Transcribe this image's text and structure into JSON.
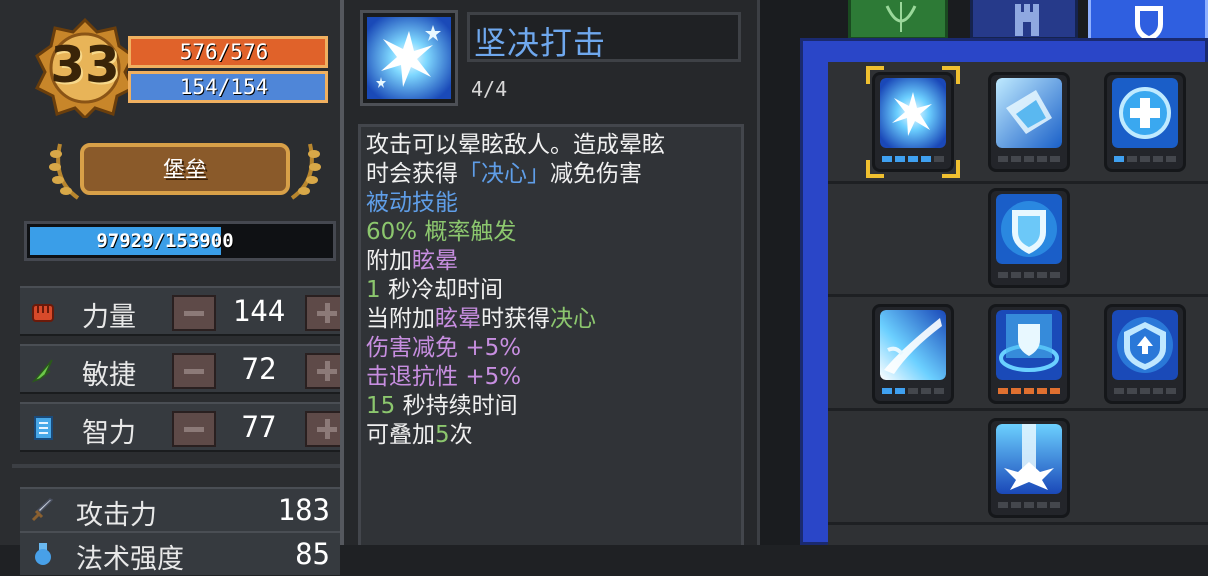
{
  "character": {
    "level": "33",
    "hp": "576/576",
    "mp": "154/154",
    "class_name": "堡垒",
    "xp": "97929/153900",
    "xp_fraction": 0.636
  },
  "attributes": [
    {
      "label": "力量",
      "value": "144",
      "icon": "fist-icon"
    },
    {
      "label": "敏捷",
      "value": "72",
      "icon": "feather-icon"
    },
    {
      "label": "智力",
      "value": "77",
      "icon": "book-icon"
    }
  ],
  "combat_stats": [
    {
      "label": "攻击力",
      "value": "183",
      "icon": "sword-icon"
    },
    {
      "label": "法术强度",
      "value": "85",
      "icon": "potion-icon"
    }
  ],
  "tooltip": {
    "skill_name": "坚决打击",
    "skill_level": "4/4",
    "lines": [
      [
        {
          "t": "攻击可以晕眩敌人。造成晕眩",
          "c": ""
        }
      ],
      [
        {
          "t": "时会获得",
          "c": ""
        },
        {
          "t": "「决心」",
          "c": "blue"
        },
        {
          "t": "减免伤害",
          "c": ""
        }
      ],
      [
        {
          "t": "被动技能",
          "c": "blue"
        }
      ],
      [
        {
          "t": "60% 概率触发",
          "c": "green"
        }
      ],
      [
        {
          "t": "附加",
          "c": ""
        },
        {
          "t": "眩晕",
          "c": "purple"
        }
      ],
      [
        {
          "t": "1",
          "c": "green"
        },
        {
          "t": " 秒冷却时间",
          "c": ""
        }
      ],
      [
        {
          "t": "当附加",
          "c": ""
        },
        {
          "t": "眩晕",
          "c": "purple"
        },
        {
          "t": "时获得",
          "c": ""
        },
        {
          "t": "决心",
          "c": "green"
        }
      ],
      [
        {
          "t": "伤害减免 ",
          "c": "purple"
        },
        {
          "t": "+5%",
          "c": "purple"
        }
      ],
      [
        {
          "t": "击退抗性 ",
          "c": "purple"
        },
        {
          "t": "+5%",
          "c": "purple"
        }
      ],
      [
        {
          "t": "15",
          "c": "green"
        },
        {
          "t": " 秒持续时间",
          "c": ""
        }
      ],
      [
        {
          "t": "可叠加",
          "c": ""
        },
        {
          "t": "5",
          "c": "green"
        },
        {
          "t": "次",
          "c": ""
        }
      ]
    ]
  },
  "skill_tree": {
    "tabs": [
      "archer-tab",
      "tower-tab",
      "shield-tab"
    ],
    "nodes": [
      {
        "name": "resolute-strike-node",
        "selected": true,
        "pips": [
          1,
          1,
          1,
          1,
          0
        ],
        "pip_color": "blue"
      },
      {
        "name": "charging-shield-node",
        "selected": false,
        "pips": [
          0,
          0,
          0,
          0,
          0
        ],
        "pip_color": "blue"
      },
      {
        "name": "healing-cross-node",
        "selected": false,
        "pips": [
          1,
          0,
          0,
          0,
          0
        ],
        "pip_color": "blue"
      },
      {
        "name": "shield-guard-node",
        "selected": false,
        "pips": [
          0,
          0,
          0,
          0,
          0
        ],
        "pip_color": "blue"
      },
      {
        "name": "slash-wave-node",
        "selected": false,
        "pips": [
          1,
          1,
          0,
          0,
          0
        ],
        "pip_color": "blue"
      },
      {
        "name": "shield-barrier-node",
        "selected": false,
        "pips": [
          1,
          1,
          1,
          1,
          1
        ],
        "pip_color": "orange"
      },
      {
        "name": "shield-upgrade-node",
        "selected": false,
        "pips": [
          0,
          0,
          0,
          0,
          0
        ],
        "pip_color": "blue"
      },
      {
        "name": "ground-slam-node",
        "selected": false,
        "pips": [
          0,
          0,
          0,
          0,
          0
        ],
        "pip_color": "blue"
      }
    ]
  },
  "colors": {
    "hp": "#e0622a",
    "mp": "#4f86d8",
    "xp": "#3a9ee8",
    "skill_name": "#6fa8ee",
    "tree_frame": "#2a46c8",
    "gold": "#f0c030"
  }
}
